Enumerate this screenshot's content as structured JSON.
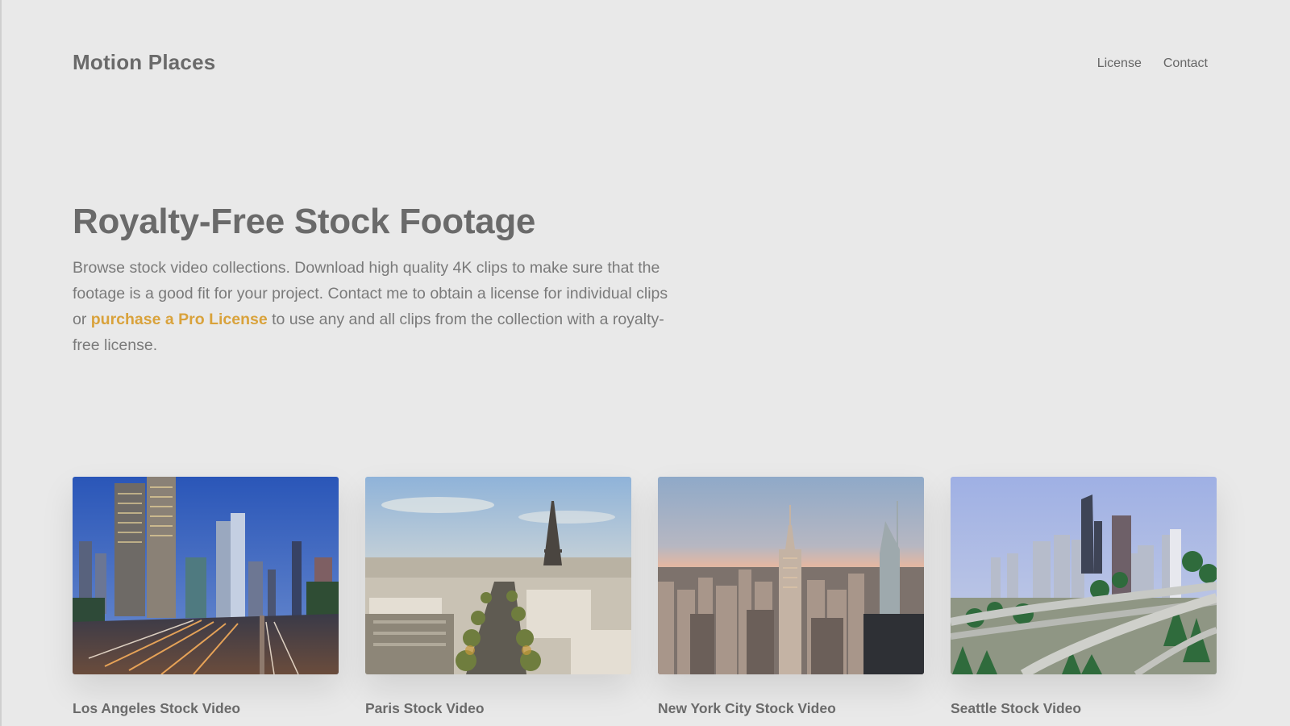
{
  "header": {
    "brand": "Motion Places",
    "nav": [
      {
        "label": "License"
      },
      {
        "label": "Contact"
      }
    ]
  },
  "hero": {
    "title": "Royalty-Free Stock Footage",
    "text_before": "Browse stock video collections. Download high quality 4K clips to make sure that the footage is a good fit for your project. Contact me to obtain a license for individual clips or ",
    "link_label": "purchase a Pro License",
    "text_after": " to use any and all clips from the collection with a royalty-free license.",
    "link_color": "#d9a23b"
  },
  "collections": [
    {
      "title": "Los Angeles Stock Video",
      "image": "los-angeles-city-skyline-freeway-image"
    },
    {
      "title": "Paris Stock Video",
      "image": "paris-eiffel-tower-cityscape-image"
    },
    {
      "title": "New York City Stock Video",
      "image": "new-york-empire-state-skyline-image"
    },
    {
      "title": "Seattle Stock Video",
      "image": "seattle-skyline-freeway-image"
    }
  ]
}
